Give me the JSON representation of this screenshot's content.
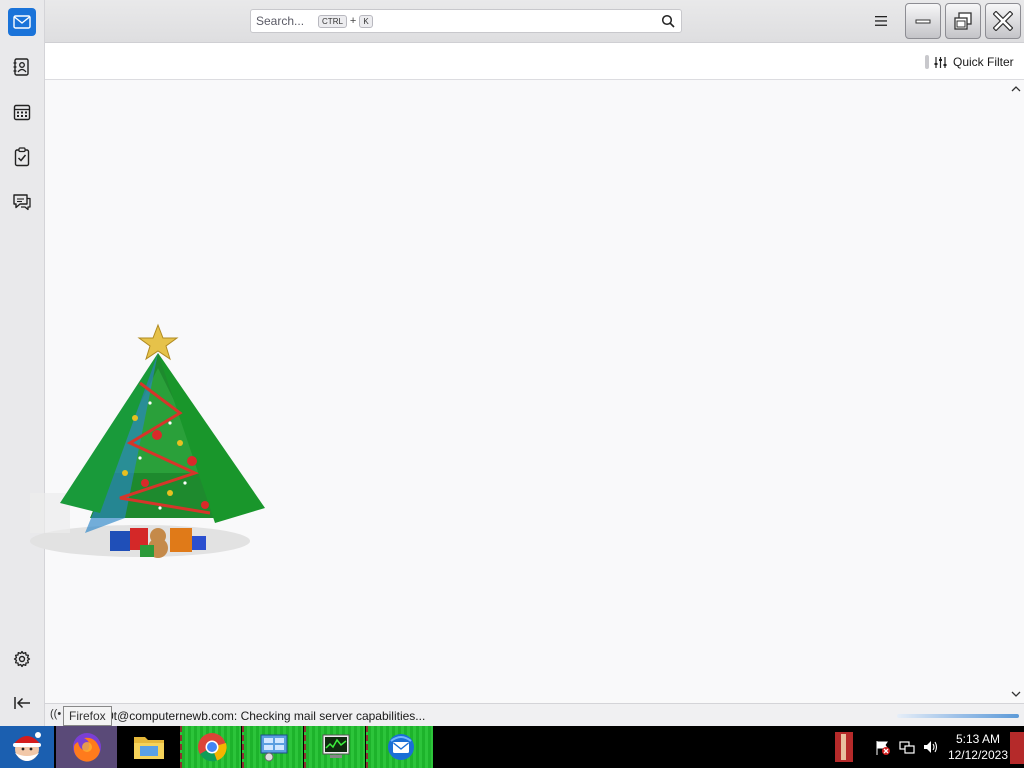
{
  "search": {
    "placeholder": "Search...",
    "shortcut_mod": "CTRL",
    "shortcut_plus": "+",
    "shortcut_key": "K"
  },
  "header": {
    "quick_filter_label": "Quick Filter"
  },
  "status": {
    "activity_glyph": "((•",
    "message": "0t@computernewb.com: Checking mail server capabilities..."
  },
  "tooltip": {
    "text": "Firefox"
  },
  "taskbar": {
    "time": "5:13 AM",
    "date": "12/12/2023"
  },
  "colors": {
    "mail_accent": "#1a73d9",
    "taskbar_bg": "#000000",
    "active_app_green": "#2cc43a"
  },
  "icons": {
    "spaces": [
      "mail-icon",
      "address-book-icon",
      "calendar-icon",
      "tasks-icon",
      "chat-icon"
    ],
    "bottom": [
      "settings-gear-icon",
      "collapse-sidebar-icon"
    ],
    "taskbar_apps": [
      "firefox-icon",
      "file-explorer-icon",
      "chrome-icon",
      "control-panel-icon",
      "task-manager-icon",
      "thunderbird-icon"
    ]
  }
}
